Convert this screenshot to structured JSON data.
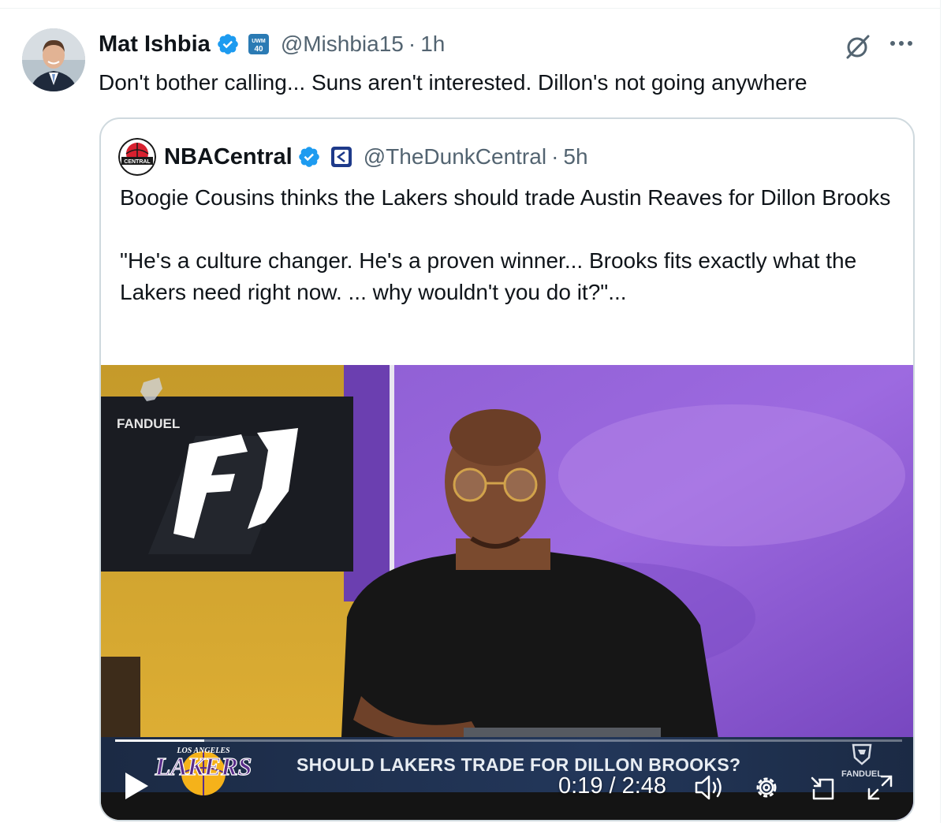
{
  "tweet": {
    "author_name": "Mat Ishbia",
    "handle": "@Mishbia15",
    "separator": "·",
    "time": "1h",
    "affiliation_badge": "UWM 40",
    "text": "Don't bother calling... Suns aren't interested. Dillon's not going anywhere"
  },
  "quote": {
    "author_name": "NBACentral",
    "handle": "@TheDunkCentral",
    "separator": "·",
    "time": "5h",
    "avatar_label": "CENTRAL",
    "text_line1": "Boogie Cousins thinks the Lakers should trade Austin Reaves for Dillon Brooks",
    "text_line2": "\"He's a culture changer. He's a proven winner... Brooks fits exactly what the Lakers need right now. ... why wouldn't you do it?\"..."
  },
  "video": {
    "lower_third": "SHOULD LAKERS TRADE FOR DILLON BROOKS?",
    "brand_left": "FANDUEL",
    "brand_right": "FANDUEL",
    "team_logo_top": "LOS ANGELES",
    "team_logo": "LAKERS",
    "time_readout": "0:19 / 2:48",
    "progress_fraction": 0.113
  },
  "icons": {
    "verified": "verified-badge-icon",
    "grok": "grok-icon",
    "more": "more-options-icon",
    "play": "play-icon",
    "volume": "volume-icon",
    "settings": "settings-gear-icon",
    "pip": "picture-in-picture-icon",
    "fullscreen": "fullscreen-icon"
  },
  "colors": {
    "verified_blue": "#1d9bf0",
    "text_primary": "#0f1419",
    "text_secondary": "#536471",
    "border": "#cfd9de"
  }
}
